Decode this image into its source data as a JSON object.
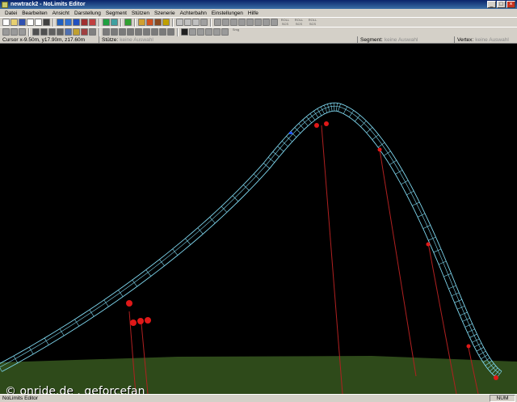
{
  "window": {
    "title": "newtrack2 - NoLimits Editor",
    "buttons": [
      "_",
      "□",
      "×"
    ]
  },
  "menu": [
    "Datei",
    "Bearbeiten",
    "Ansicht",
    "Darstellung",
    "Segment",
    "Stützen",
    "Szenerie",
    "Achterbahn",
    "Einstellungen",
    "Hilfe"
  ],
  "toolbar": {
    "row1_colors": [
      "#ffffff",
      "#e8d070",
      "#3050b0",
      "#ffffff",
      "#ffffff",
      "#404040",
      "#d4d0c8",
      "#2060c0",
      "#3070d0",
      "#2050c0",
      "#a03030",
      "#c04040",
      "#d4d0c8",
      "#20a040",
      "#40a0a0",
      "#d4d0c8",
      "#30a030",
      "#d4d0c8",
      "#d0a030",
      "#d05020",
      "#8a4a20",
      "#c0a000",
      "#d4d0c8",
      "#c0c0c0",
      "#c0c0c0",
      "#c0c0c0",
      "#a0a0a0",
      "#d4d0c8",
      "#9a9a9a",
      "#9a9a9a",
      "#9a9a9a",
      "#9a9a9a",
      "#9a9a9a",
      "#9a9a9a",
      "#9a9a9a",
      "#9a9a9a"
    ],
    "row1_text_buttons": [
      "ROLL SCS",
      "ROLL SCS",
      "ROLL SCS"
    ],
    "row2_colors": [
      "#9a9a9a",
      "#9a9a9a",
      "#9a9a9a",
      "#d4d0c8",
      "#505050",
      "#505050",
      "#606060",
      "#606060",
      "#5070b0",
      "#c0a030",
      "#a04040",
      "#808080",
      "#d4d0c8",
      "#7a7a7a",
      "#7a7a7a",
      "#7a7a7a",
      "#7a7a7a",
      "#7a7a7a",
      "#7a7a7a",
      "#7a7a7a",
      "#7a7a7a",
      "#7a7a7a",
      "#d4d0c8",
      "#202020",
      "#9a9a9a",
      "#9a9a9a",
      "#9a9a9a",
      "#9a9a9a",
      "#9a9a9a"
    ],
    "row2_text_button": "Smg"
  },
  "status_fields": {
    "cursor_label": "Cursor",
    "cursor_value": "x-9.50m, y17.90m, z17.60m",
    "support_label": "Stütze:",
    "support_value": "keine Auswahl",
    "segment_label": "Segment:",
    "segment_value": "keine Auswahl",
    "vertex_label": "Vertex:",
    "vertex_value": "keine Auswahl"
  },
  "scene": {
    "background": "#000000",
    "ground_color": "#2e4a1a",
    "track_color": "#7fd8f0",
    "support_color": "#b02020",
    "node_color": "#e01818",
    "selected_vertex_color": "#2050ff"
  },
  "watermark": "© onride.de . geforcefan",
  "statusbar": {
    "left": "NoLimits Editor",
    "right": "NUM"
  }
}
